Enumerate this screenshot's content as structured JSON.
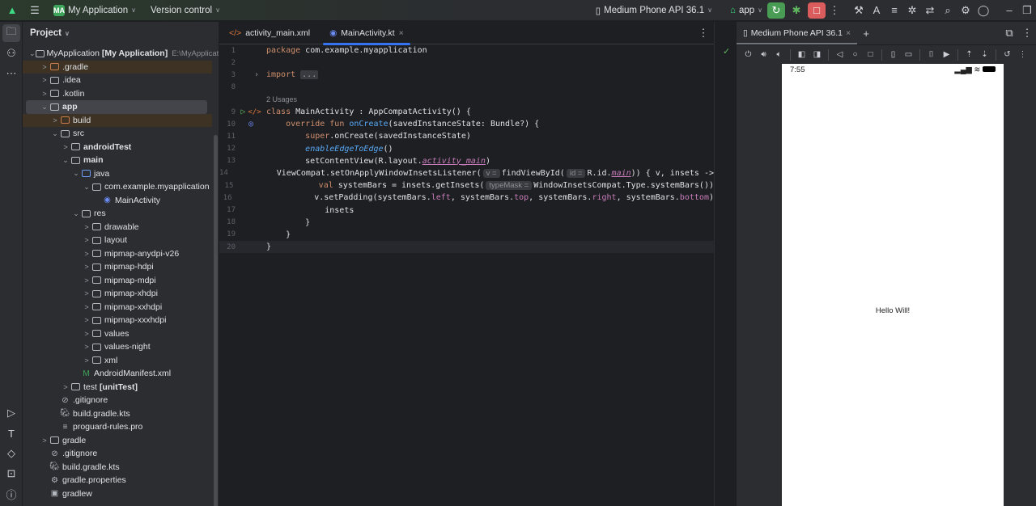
{
  "titlebar": {
    "project_badge": "MA",
    "project_name": "My Application",
    "vcs": "Version control",
    "device": "Medium Phone API 36.1",
    "run_config": "app"
  },
  "project_panel": {
    "title": "Project",
    "tree": [
      {
        "label": "MyApplication",
        "bold_suffix": "[My Application]",
        "path": "E:\\MyApplication",
        "level": 0,
        "arrow": "v",
        "icon": "module"
      },
      {
        "label": ".gradle",
        "level": 1,
        "arrow": ">",
        "icon": "folder-orange",
        "hl": true
      },
      {
        "label": ".idea",
        "level": 1,
        "arrow": ">",
        "icon": "folder"
      },
      {
        "label": ".kotlin",
        "level": 1,
        "arrow": ">",
        "icon": "folder"
      },
      {
        "label": "app",
        "level": 1,
        "arrow": "v",
        "icon": "module",
        "bold": true,
        "sel": true
      },
      {
        "label": "build",
        "level": 2,
        "arrow": ">",
        "icon": "folder-orange",
        "hl": true
      },
      {
        "label": "src",
        "level": 2,
        "arrow": "v",
        "icon": "folder"
      },
      {
        "label": "androidTest",
        "level": 3,
        "arrow": ">",
        "icon": "folder",
        "bold": true
      },
      {
        "label": "main",
        "level": 3,
        "arrow": "v",
        "icon": "folder",
        "bold": true
      },
      {
        "label": "java",
        "level": 4,
        "arrow": "v",
        "icon": "folder-blue"
      },
      {
        "label": "com.example.myapplication",
        "level": 5,
        "arrow": "v",
        "icon": "package"
      },
      {
        "label": "MainActivity",
        "level": 6,
        "arrow": "",
        "icon": "kotlin-class"
      },
      {
        "label": "res",
        "level": 4,
        "arrow": "v",
        "icon": "folder"
      },
      {
        "label": "drawable",
        "level": 5,
        "arrow": ">",
        "icon": "folder"
      },
      {
        "label": "layout",
        "level": 5,
        "arrow": ">",
        "icon": "folder"
      },
      {
        "label": "mipmap-anydpi-v26",
        "level": 5,
        "arrow": ">",
        "icon": "folder"
      },
      {
        "label": "mipmap-hdpi",
        "level": 5,
        "arrow": ">",
        "icon": "folder"
      },
      {
        "label": "mipmap-mdpi",
        "level": 5,
        "arrow": ">",
        "icon": "folder"
      },
      {
        "label": "mipmap-xhdpi",
        "level": 5,
        "arrow": ">",
        "icon": "folder"
      },
      {
        "label": "mipmap-xxhdpi",
        "level": 5,
        "arrow": ">",
        "icon": "folder"
      },
      {
        "label": "mipmap-xxxhdpi",
        "level": 5,
        "arrow": ">",
        "icon": "folder"
      },
      {
        "label": "values",
        "level": 5,
        "arrow": ">",
        "icon": "folder"
      },
      {
        "label": "values-night",
        "level": 5,
        "arrow": ">",
        "icon": "folder"
      },
      {
        "label": "xml",
        "level": 5,
        "arrow": ">",
        "icon": "folder"
      },
      {
        "label": "AndroidManifest.xml",
        "level": 4,
        "arrow": "",
        "icon": "manifest"
      },
      {
        "label": "test",
        "bold_suffix": "[unitTest]",
        "level": 3,
        "arrow": ">",
        "icon": "module"
      },
      {
        "label": ".gitignore",
        "level": 2,
        "arrow": "",
        "icon": "ignore"
      },
      {
        "label": "build.gradle.kts",
        "level": 2,
        "arrow": "",
        "icon": "gradle"
      },
      {
        "label": "proguard-rules.pro",
        "level": 2,
        "arrow": "",
        "icon": "text"
      },
      {
        "label": "gradle",
        "level": 1,
        "arrow": ">",
        "icon": "folder"
      },
      {
        "label": ".gitignore",
        "level": 1,
        "arrow": "",
        "icon": "ignore"
      },
      {
        "label": "build.gradle.kts",
        "level": 1,
        "arrow": "",
        "icon": "gradle"
      },
      {
        "label": "gradle.properties",
        "level": 1,
        "arrow": "",
        "icon": "gear"
      },
      {
        "label": "gradlew",
        "level": 1,
        "arrow": "",
        "icon": "terminal"
      }
    ]
  },
  "editor": {
    "tabs": [
      {
        "label": "activity_main.xml",
        "active": false
      },
      {
        "label": "MainActivity.kt",
        "active": true
      }
    ],
    "lines": [
      {
        "n": "1",
        "t": [
          [
            "kw",
            "package "
          ],
          [
            "",
            "com.example.myapplication"
          ]
        ]
      },
      {
        "n": "2",
        "t": []
      },
      {
        "n": "3",
        "fold": ">",
        "t": [
          [
            "kw",
            "import "
          ],
          [
            "fold",
            "..."
          ]
        ]
      },
      {
        "n": "8",
        "t": []
      },
      {
        "n": "",
        "usages": "2 Usages"
      },
      {
        "n": "9",
        "gutter": "run",
        "t": [
          [
            "kw",
            "class "
          ],
          [
            "",
            "MainActivity : AppCompatActivity() {"
          ]
        ]
      },
      {
        "n": "10",
        "gutter": "override",
        "t": [
          [
            "",
            "    "
          ],
          [
            "kw",
            "override fun "
          ],
          [
            "fn",
            "onCreate"
          ],
          [
            "",
            "(savedInstanceState: Bundle?) {"
          ]
        ]
      },
      {
        "n": "11",
        "t": [
          [
            "",
            "        "
          ],
          [
            "kw",
            "super"
          ],
          [
            "",
            ".onCreate(savedInstanceState)"
          ]
        ]
      },
      {
        "n": "12",
        "t": [
          [
            "",
            "        "
          ],
          [
            "it",
            "enableEdgeToEdge"
          ],
          [
            "",
            "()"
          ]
        ]
      },
      {
        "n": "13",
        "t": [
          [
            "",
            "        setContentView(R.layout."
          ],
          [
            "pu",
            "activity_main"
          ],
          [
            "",
            ")"
          ]
        ]
      },
      {
        "n": "14",
        "t": [
          [
            "",
            "        ViewCompat.setOnApplyWindowInsetsListener("
          ],
          [
            "hint",
            "v ="
          ],
          [
            "",
            "findViewById("
          ],
          [
            "hint",
            "id ="
          ],
          [
            "",
            "R.id."
          ],
          [
            "pu",
            "main"
          ],
          [
            "",
            "))"
          ],
          [
            "",
            " { v, insets ->"
          ]
        ]
      },
      {
        "n": "15",
        "t": [
          [
            "",
            "            "
          ],
          [
            "kw",
            "val "
          ],
          [
            "",
            "systemBars = insets.getInsets("
          ],
          [
            "hint",
            "typeMask ="
          ],
          [
            "",
            "WindowInsetsCompat.Type.systemBars())"
          ]
        ]
      },
      {
        "n": "16",
        "t": [
          [
            "",
            "            v.setPadding(systemBars."
          ],
          [
            "pp",
            "left"
          ],
          [
            "",
            ", systemBars."
          ],
          [
            "pp",
            "top"
          ],
          [
            "",
            ", systemBars."
          ],
          [
            "pp",
            "right"
          ],
          [
            "",
            ", systemBars."
          ],
          [
            "pp",
            "bottom"
          ],
          [
            "",
            ")"
          ]
        ]
      },
      {
        "n": "17",
        "t": [
          [
            "",
            "            insets"
          ]
        ]
      },
      {
        "n": "18",
        "t": [
          [
            "",
            "        }"
          ]
        ]
      },
      {
        "n": "19",
        "t": [
          [
            "",
            "    }"
          ]
        ]
      },
      {
        "n": "20",
        "cur": true,
        "t": [
          [
            "",
            "}"
          ]
        ]
      }
    ]
  },
  "running_devices": {
    "tab": "Medium Phone API 36.1",
    "time": "7:55",
    "app_text": "Hello Will!"
  },
  "colors": {
    "accent": "#3574f0",
    "run_green": "#499c54",
    "stop_red": "#db5c5c"
  }
}
